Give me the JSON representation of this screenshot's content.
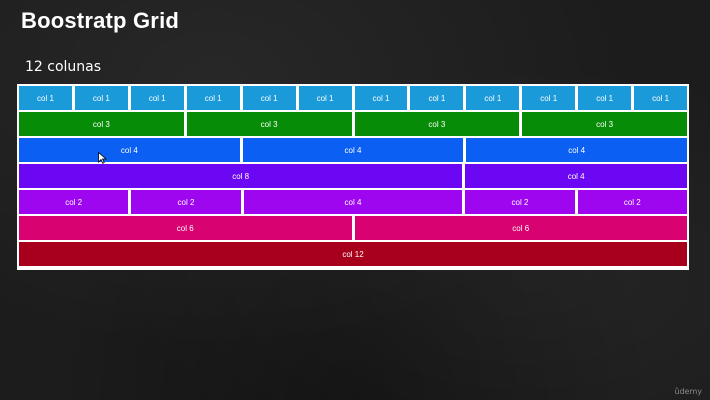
{
  "slide": {
    "title": "Boostratp Grid",
    "subtitle": "12 colunas",
    "watermark": "ûdemy"
  },
  "grid": {
    "rows": [
      {
        "color": "#1a9ad9",
        "cells": [
          {
            "label": "col 1",
            "span": 1
          },
          {
            "label": "col 1",
            "span": 1
          },
          {
            "label": "col 1",
            "span": 1
          },
          {
            "label": "col 1",
            "span": 1
          },
          {
            "label": "col 1",
            "span": 1
          },
          {
            "label": "col 1",
            "span": 1
          },
          {
            "label": "col 1",
            "span": 1
          },
          {
            "label": "col 1",
            "span": 1
          },
          {
            "label": "col 1",
            "span": 1
          },
          {
            "label": "col 1",
            "span": 1
          },
          {
            "label": "col 1",
            "span": 1
          },
          {
            "label": "col 1",
            "span": 1
          }
        ]
      },
      {
        "color": "#068c06",
        "cells": [
          {
            "label": "col 3",
            "span": 3
          },
          {
            "label": "col 3",
            "span": 3
          },
          {
            "label": "col 3",
            "span": 3
          },
          {
            "label": "col 3",
            "span": 3
          }
        ]
      },
      {
        "color": "#0b5ff3",
        "cells": [
          {
            "label": "col 4",
            "span": 4
          },
          {
            "label": "col 4",
            "span": 4
          },
          {
            "label": "col 4",
            "span": 4
          }
        ]
      },
      {
        "color": "#6b07f2",
        "cells": [
          {
            "label": "col 8",
            "span": 8
          },
          {
            "label": "col 4",
            "span": 4
          }
        ]
      },
      {
        "color": "#9e06f0",
        "cells": [
          {
            "label": "col 2",
            "span": 2
          },
          {
            "label": "col 2",
            "span": 2
          },
          {
            "label": "col 4",
            "span": 4
          },
          {
            "label": "col 2",
            "span": 2
          },
          {
            "label": "col 2",
            "span": 2
          }
        ]
      },
      {
        "color": "#d80370",
        "cells": [
          {
            "label": "col 6",
            "span": 6
          },
          {
            "label": "col 6",
            "span": 6
          }
        ]
      },
      {
        "color": "#a8001c",
        "cells": [
          {
            "label": "col 12",
            "span": 12
          }
        ]
      }
    ]
  }
}
